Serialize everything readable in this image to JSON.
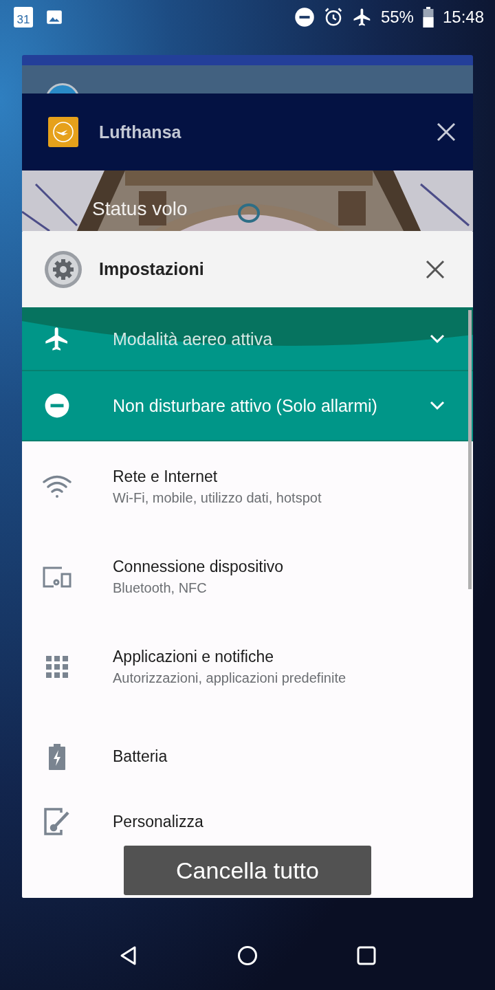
{
  "status_bar": {
    "calendar_date": "31",
    "battery_percent": "55%",
    "time": "15:48"
  },
  "lufthansa_card": {
    "title": "Lufthansa",
    "content_text": "Status volo"
  },
  "settings_card": {
    "title": "Impostazioni",
    "conditions": [
      {
        "kind": "airplane",
        "title": "Modalità aereo attiva",
        "expanded": false
      },
      {
        "kind": "dnd",
        "title": "Non disturbare attivo (Solo allarmi)",
        "expanded": false
      }
    ],
    "items": [
      {
        "kind": "network",
        "title": "Rete e Internet",
        "subtitle": "Wi-Fi, mobile, utilizzo dati, hotspot"
      },
      {
        "kind": "devices",
        "title": "Connessione dispositivo",
        "subtitle": "Bluetooth, NFC"
      },
      {
        "kind": "apps",
        "title": "Applicazioni e notifiche",
        "subtitle": "Autorizzazioni, applicazioni predefinite"
      },
      {
        "kind": "battery",
        "title": "Batteria"
      },
      {
        "kind": "display",
        "title": "Personalizza"
      }
    ]
  },
  "clear_all_button": "Cancella tutto"
}
